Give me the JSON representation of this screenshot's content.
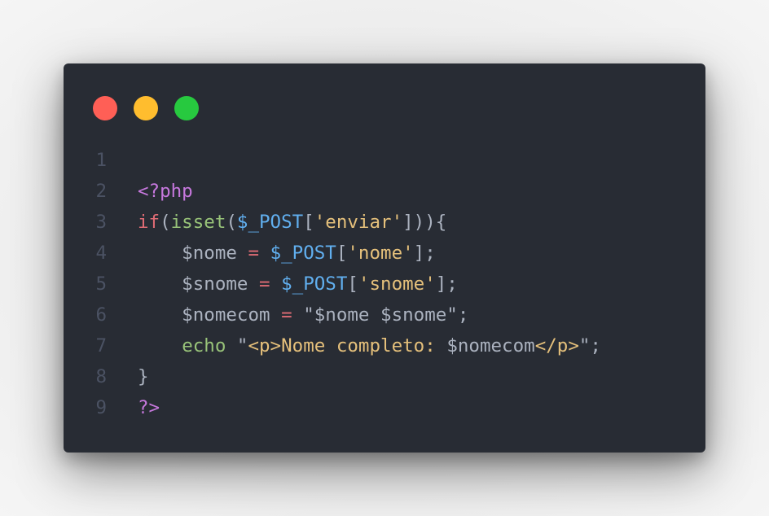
{
  "window": {
    "controls": {
      "close_color": "#ff5f56",
      "minimize_color": "#ffbd2e",
      "maximize_color": "#27c93f"
    }
  },
  "code": {
    "lines": [
      {
        "number": "1",
        "tokens": []
      },
      {
        "number": "2",
        "tokens": [
          {
            "text": "<?php",
            "type": "purple"
          }
        ]
      },
      {
        "number": "3",
        "tokens": [
          {
            "text": "if",
            "type": "red"
          },
          {
            "text": "(",
            "type": "plain"
          },
          {
            "text": "isset",
            "type": "green"
          },
          {
            "text": "(",
            "type": "plain"
          },
          {
            "text": "$_POST",
            "type": "blue"
          },
          {
            "text": "[",
            "type": "plain"
          },
          {
            "text": "'enviar'",
            "type": "yellow"
          },
          {
            "text": "])){",
            "type": "plain"
          }
        ]
      },
      {
        "number": "4",
        "tokens": [
          {
            "text": "    $nome ",
            "type": "plain"
          },
          {
            "text": "=",
            "type": "red"
          },
          {
            "text": " ",
            "type": "plain"
          },
          {
            "text": "$_POST",
            "type": "blue"
          },
          {
            "text": "[",
            "type": "plain"
          },
          {
            "text": "'nome'",
            "type": "yellow"
          },
          {
            "text": "];",
            "type": "plain"
          }
        ]
      },
      {
        "number": "5",
        "tokens": [
          {
            "text": "    $snome ",
            "type": "plain"
          },
          {
            "text": "=",
            "type": "red"
          },
          {
            "text": " ",
            "type": "plain"
          },
          {
            "text": "$_POST",
            "type": "blue"
          },
          {
            "text": "[",
            "type": "plain"
          },
          {
            "text": "'snome'",
            "type": "yellow"
          },
          {
            "text": "];",
            "type": "plain"
          }
        ]
      },
      {
        "number": "6",
        "tokens": [
          {
            "text": "    $nomecom ",
            "type": "plain"
          },
          {
            "text": "=",
            "type": "red"
          },
          {
            "text": " \"$nome $snome\";",
            "type": "plain"
          }
        ]
      },
      {
        "number": "7",
        "tokens": [
          {
            "text": "    ",
            "type": "plain"
          },
          {
            "text": "echo",
            "type": "green"
          },
          {
            "text": " \"",
            "type": "plain"
          },
          {
            "text": "<p>Nome completo: ",
            "type": "yellow"
          },
          {
            "text": "$nomecom",
            "type": "plain"
          },
          {
            "text": "</p>",
            "type": "yellow"
          },
          {
            "text": "\";",
            "type": "plain"
          }
        ]
      },
      {
        "number": "8",
        "tokens": [
          {
            "text": "}",
            "type": "plain"
          }
        ]
      },
      {
        "number": "9",
        "tokens": [
          {
            "text": "?>",
            "type": "purple"
          }
        ]
      }
    ]
  }
}
